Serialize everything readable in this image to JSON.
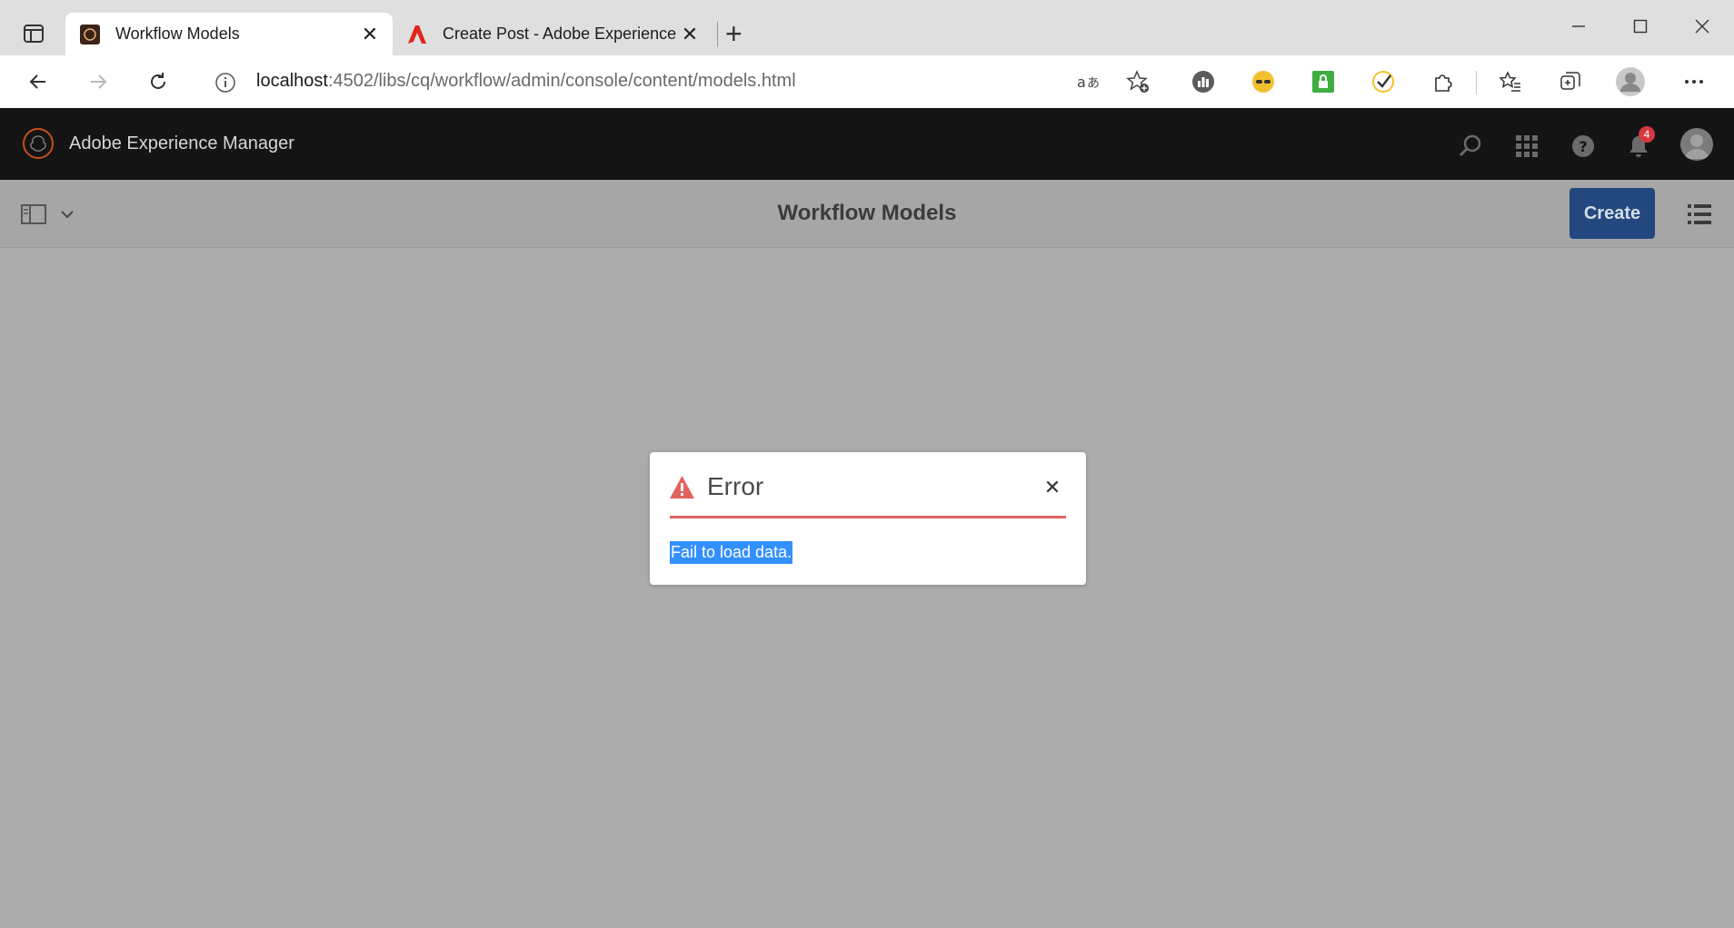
{
  "browser": {
    "tabs": [
      {
        "title": "Workflow Models",
        "active": true
      },
      {
        "title": "Create Post - Adobe Experience",
        "active": false
      }
    ],
    "url_host": "localhost",
    "url_path": ":4502/libs/cq/workflow/admin/console/content/models.html",
    "new_tab_glyph": "+",
    "close_glyph": "✕"
  },
  "aem": {
    "product_name": "Adobe Experience Manager",
    "notification_count": "4",
    "page_title": "Workflow Models",
    "create_label": "Create"
  },
  "dialog": {
    "title": "Error",
    "message": "Fail to load data.",
    "close_glyph": "✕",
    "accent_color": "#e3635f"
  },
  "colors": {
    "header_bg": "#141414",
    "overlay": "#ababab",
    "primary_button": "#23477f",
    "selection": "#3390ff"
  }
}
